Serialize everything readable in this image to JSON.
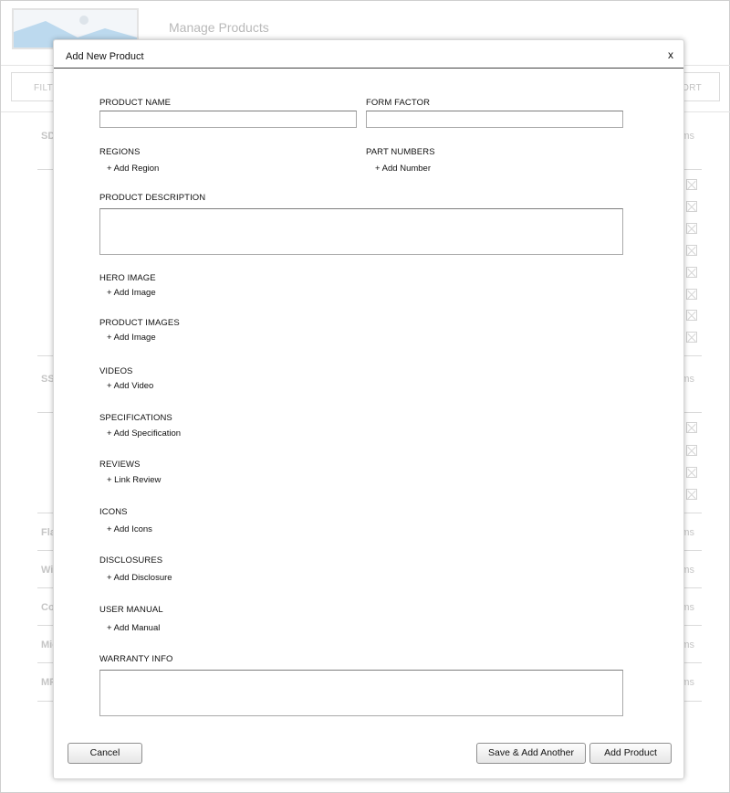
{
  "background": {
    "page_title": "Manage Products",
    "filter_label": "FILTE",
    "sort_label": "ORT",
    "categories": [
      "SD",
      "SS",
      "Fla",
      "Wi",
      "Co",
      "Mic",
      "MP"
    ],
    "items_label": "ms"
  },
  "modal": {
    "title": "Add New Product",
    "close_label": "x",
    "product_name": {
      "label": "PRODUCT NAME",
      "value": "",
      "placeholder": ""
    },
    "form_factor": {
      "label": "FORM FACTOR",
      "value": "",
      "placeholder": ""
    },
    "regions": {
      "label": "REGIONS",
      "action": "+ Add Region"
    },
    "part_numbers": {
      "label": "PART NUMBERS",
      "action": "+ Add Number"
    },
    "product_description": {
      "label": "PRODUCT DESCRIPTION",
      "value": ""
    },
    "hero_image": {
      "label": "HERO IMAGE",
      "action": "+ Add Image"
    },
    "product_images": {
      "label": "PRODUCT IMAGES",
      "action": "+ Add Image"
    },
    "videos": {
      "label": "VIDEOS",
      "action": "+ Add Video"
    },
    "specifications": {
      "label": "SPECIFICATIONS",
      "action": "+ Add Specification"
    },
    "reviews": {
      "label": "REVIEWS",
      "action": "+ Link Review"
    },
    "icons": {
      "label": "ICONS",
      "action": "+ Add Icons"
    },
    "disclosures": {
      "label": "DISCLOSURES",
      "action": "+ Add Disclosure"
    },
    "user_manual": {
      "label": "USER MANUAL",
      "action": "+ Add Manual"
    },
    "warranty_info": {
      "label": "WARRANTY INFO",
      "value": ""
    },
    "buttons": {
      "cancel": "Cancel",
      "save_add_another": "Save & Add Another",
      "add_product": "Add Product"
    }
  }
}
